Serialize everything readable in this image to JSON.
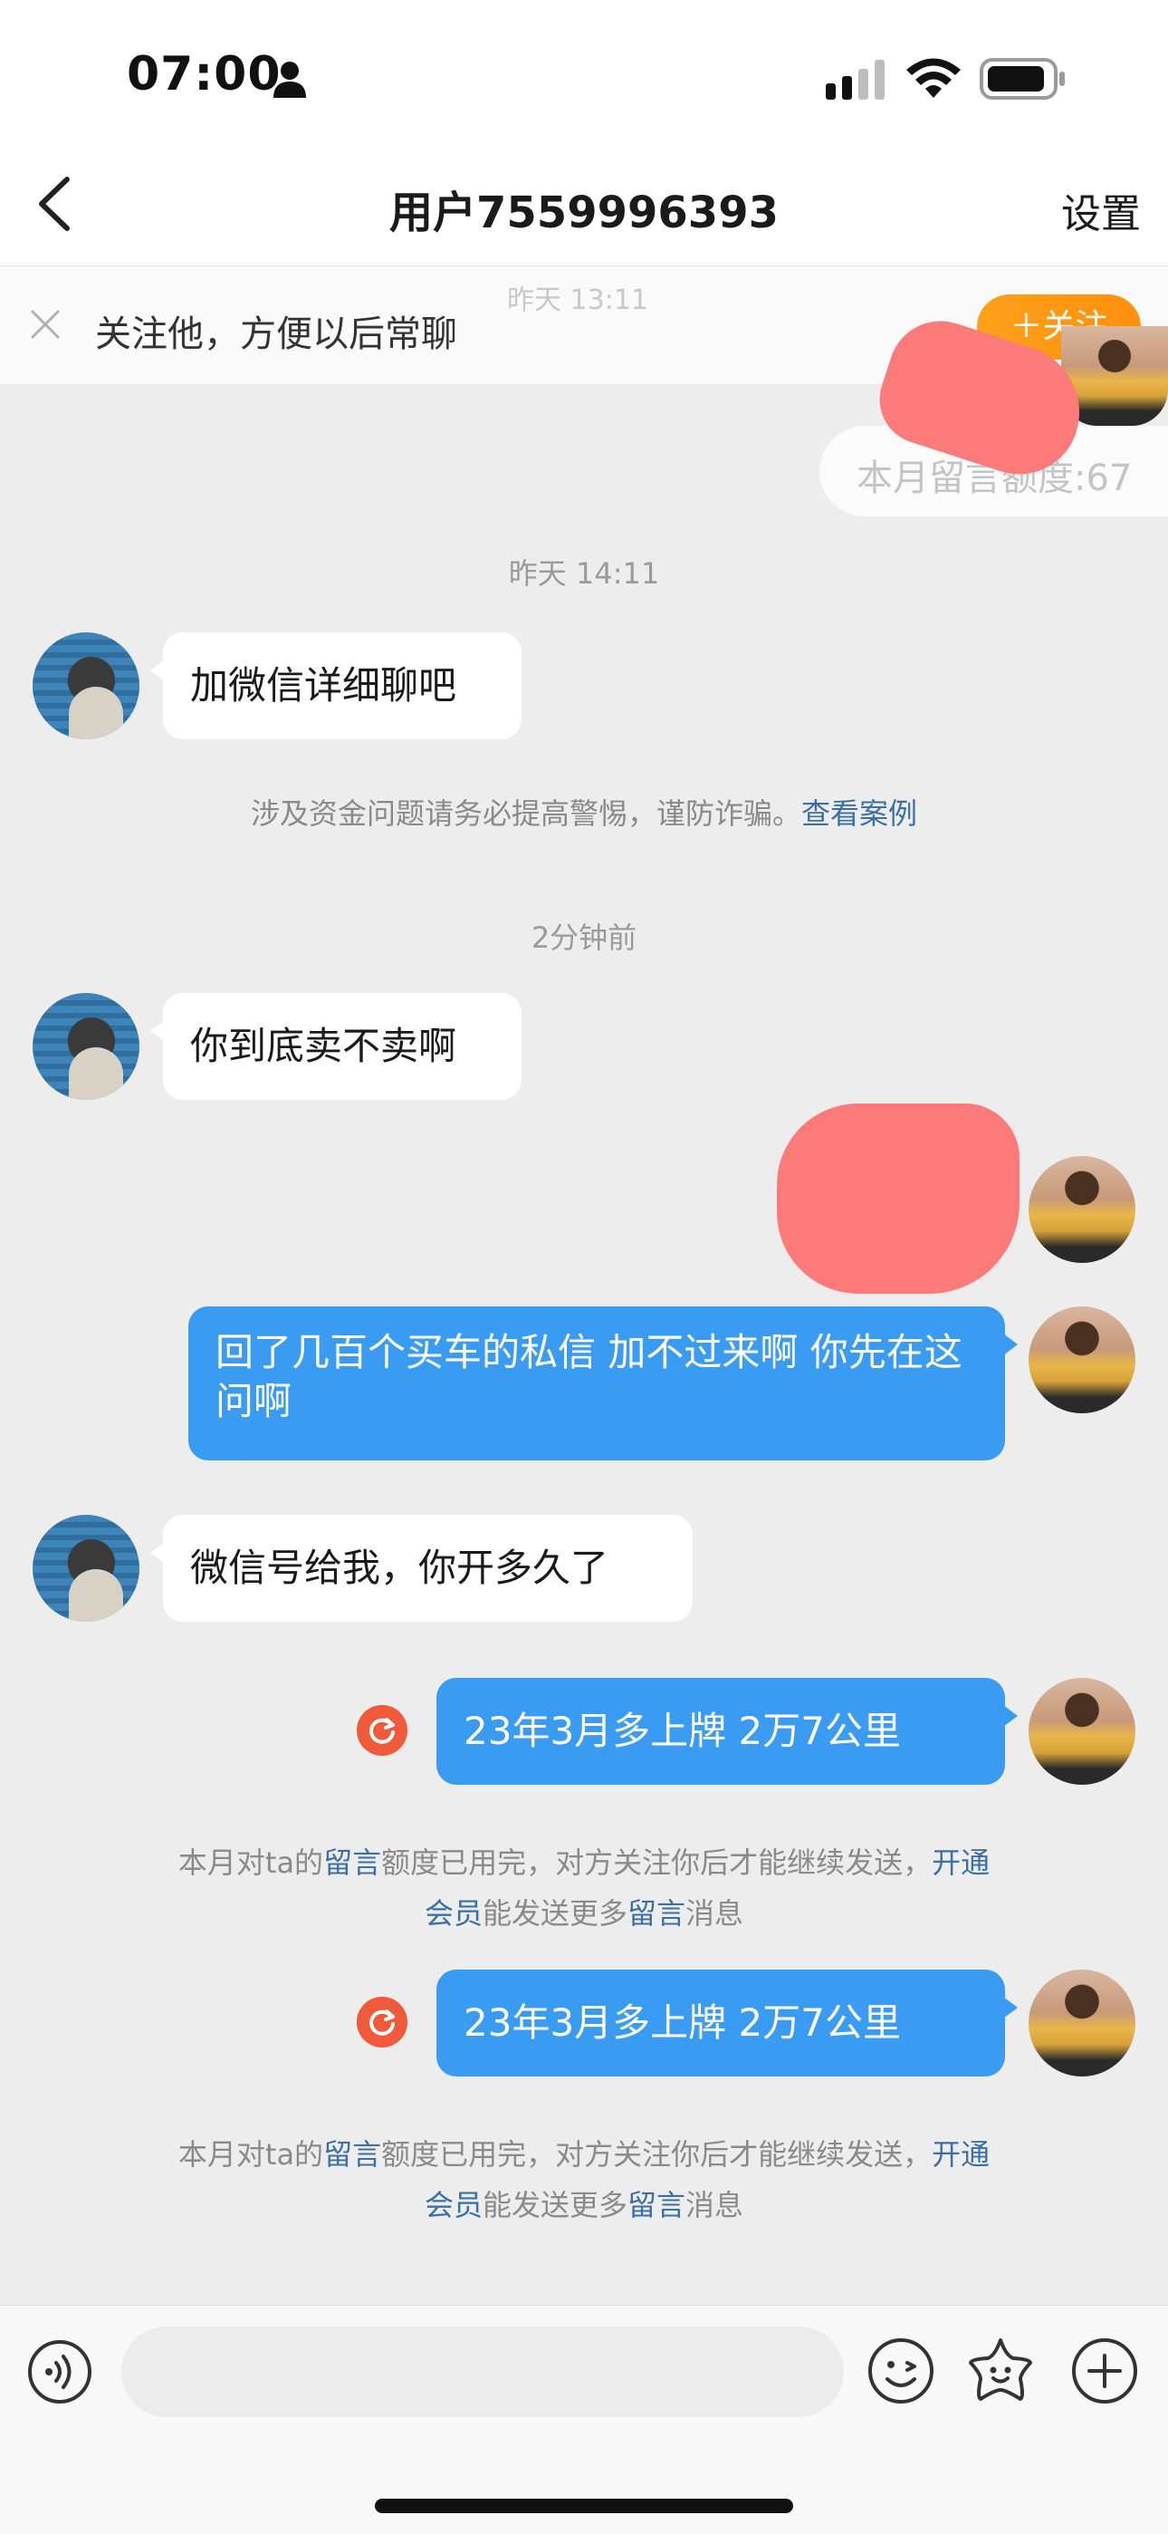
{
  "status": {
    "time": "07:00"
  },
  "header": {
    "title": "用户7559996393",
    "settings": "设置"
  },
  "banner": {
    "text": "关注他，方便以后常聊",
    "follow": "＋关注",
    "ghost_time": "昨天 13:11"
  },
  "messages": {
    "quota_top": "本月留言额度:67",
    "ts1": "昨天 14:11",
    "m1": "加微信详细聊吧",
    "warning_prefix": "涉及资金问题请务必提高警惕，谨防诈骗。",
    "warning_link": "查看案例",
    "ts2": "2分钟前",
    "m2": "你到底卖不卖啊",
    "m3": "回了几百个买车的私信 加不过来啊 你先在这问啊",
    "m4": "微信号给我，你开多久了",
    "m5": "23年3月多上牌 2万7公里",
    "m6": "23年3月多上牌 2万7公里"
  },
  "notice": {
    "p1": "本月对ta的",
    "l1": "留言",
    "p2": "额度已用完，对方关注你后才能继续发送，",
    "l2": "开通",
    "l3": "会员",
    "p3": "能发送更多",
    "l4": "留言",
    "p4": "消息"
  },
  "input": {
    "placeholder": ""
  },
  "colors": {
    "bubble_out": "#3a9bf2",
    "follow_btn": "#ff9a14",
    "link": "#3b6fa8",
    "resend": "#f05a3a"
  }
}
